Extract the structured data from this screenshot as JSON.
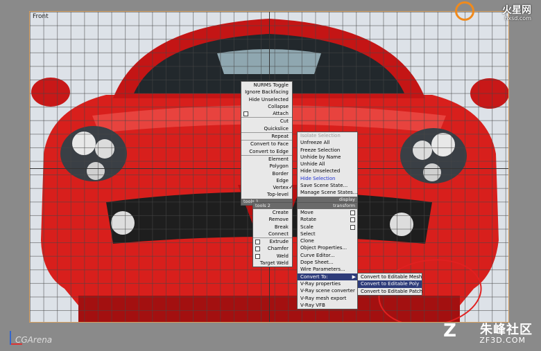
{
  "viewport": {
    "label": "Front"
  },
  "branding": {
    "top_logo": "火星网",
    "top_logo_sub": "hxsd.com",
    "bottom_logo": "朱峰社区",
    "bottom_logo_sub": "ZF3D.COM",
    "bottom_mark": "Z",
    "watermark": "CGArena"
  },
  "quad_tools1": {
    "header": "tools 1",
    "items": [
      "NURMS Toggle",
      "Ignore Backfacing",
      "Hide Unselected",
      "Collapse",
      "Attach",
      "Cut",
      "Quickslice",
      "Repeat",
      "Convert to Face",
      "Convert to Edge",
      "Element",
      "Polygon",
      "Border",
      "Edge",
      "Vertex",
      "Top-level"
    ]
  },
  "quad_display": {
    "header": "display",
    "items": [
      "Isolate Selection",
      "Unfreeze All",
      "Freeze Selection",
      "Unhide by Name",
      "Unhide All",
      "Hide Unselected",
      "Hide Selection",
      "Save Scene State...",
      "Manage Scene States..."
    ]
  },
  "quad_tools2": {
    "header": "tools 2",
    "items": [
      "Create",
      "Remove",
      "Break",
      "Connect",
      "Extrude",
      "Chamfer",
      "Weld",
      "Target Weld"
    ]
  },
  "quad_transform": {
    "header": "transform",
    "items": [
      "Move",
      "Rotate",
      "Scale",
      "Select",
      "Clone",
      "Object Properties...",
      "Curve Editor...",
      "Dope Sheet...",
      "Wire Parameters...",
      "Convert To:",
      "V-Ray properties",
      "V-Ray scene converter",
      "V-Ray mesh export",
      "V-Ray VFB"
    ]
  },
  "convert_submenu": {
    "items": [
      "Convert to Editable Mesh",
      "Convert to Editable Poly",
      "Convert to Editable Patch"
    ],
    "selected_index": 1
  },
  "colors": {
    "car_red": "#d81f1c",
    "menu_highlight": "#2e3c7a",
    "annotation": "#e02020"
  }
}
